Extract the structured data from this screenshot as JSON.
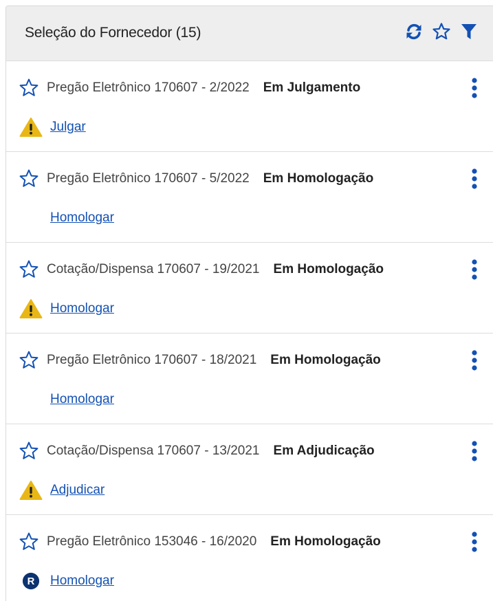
{
  "header": {
    "title": "Seleção do Fornecedor (15)",
    "icons": [
      "refresh-icon",
      "star-outline-icon",
      "filter-icon"
    ]
  },
  "colors": {
    "accent": "#1351b4",
    "warning": "#e8b716",
    "header_bg": "#eeeeee"
  },
  "items": [
    {
      "title": "Pregão Eletrônico 170607 - 2/2022",
      "status": "Em Julgamento",
      "badge": "warning-icon",
      "action": "Julgar"
    },
    {
      "title": "Pregão Eletrônico 170607 - 5/2022",
      "status": "Em Homologação",
      "badge": "",
      "action": "Homologar"
    },
    {
      "title": "Cotação/Dispensa 170607 - 19/2021",
      "status": "Em Homologação",
      "badge": "warning-icon",
      "action": "Homologar"
    },
    {
      "title": "Pregão Eletrônico 170607 - 18/2021",
      "status": "Em Homologação",
      "badge": "",
      "action": "Homologar"
    },
    {
      "title": "Cotação/Dispensa 170607 - 13/2021",
      "status": "Em Adjudicação",
      "badge": "warning-icon",
      "action": "Adjudicar"
    },
    {
      "title": "Pregão Eletrônico 153046 - 16/2020",
      "status": "Em Homologação",
      "badge": "r-badge-icon",
      "badge_text": "R",
      "action": "Homologar"
    }
  ]
}
